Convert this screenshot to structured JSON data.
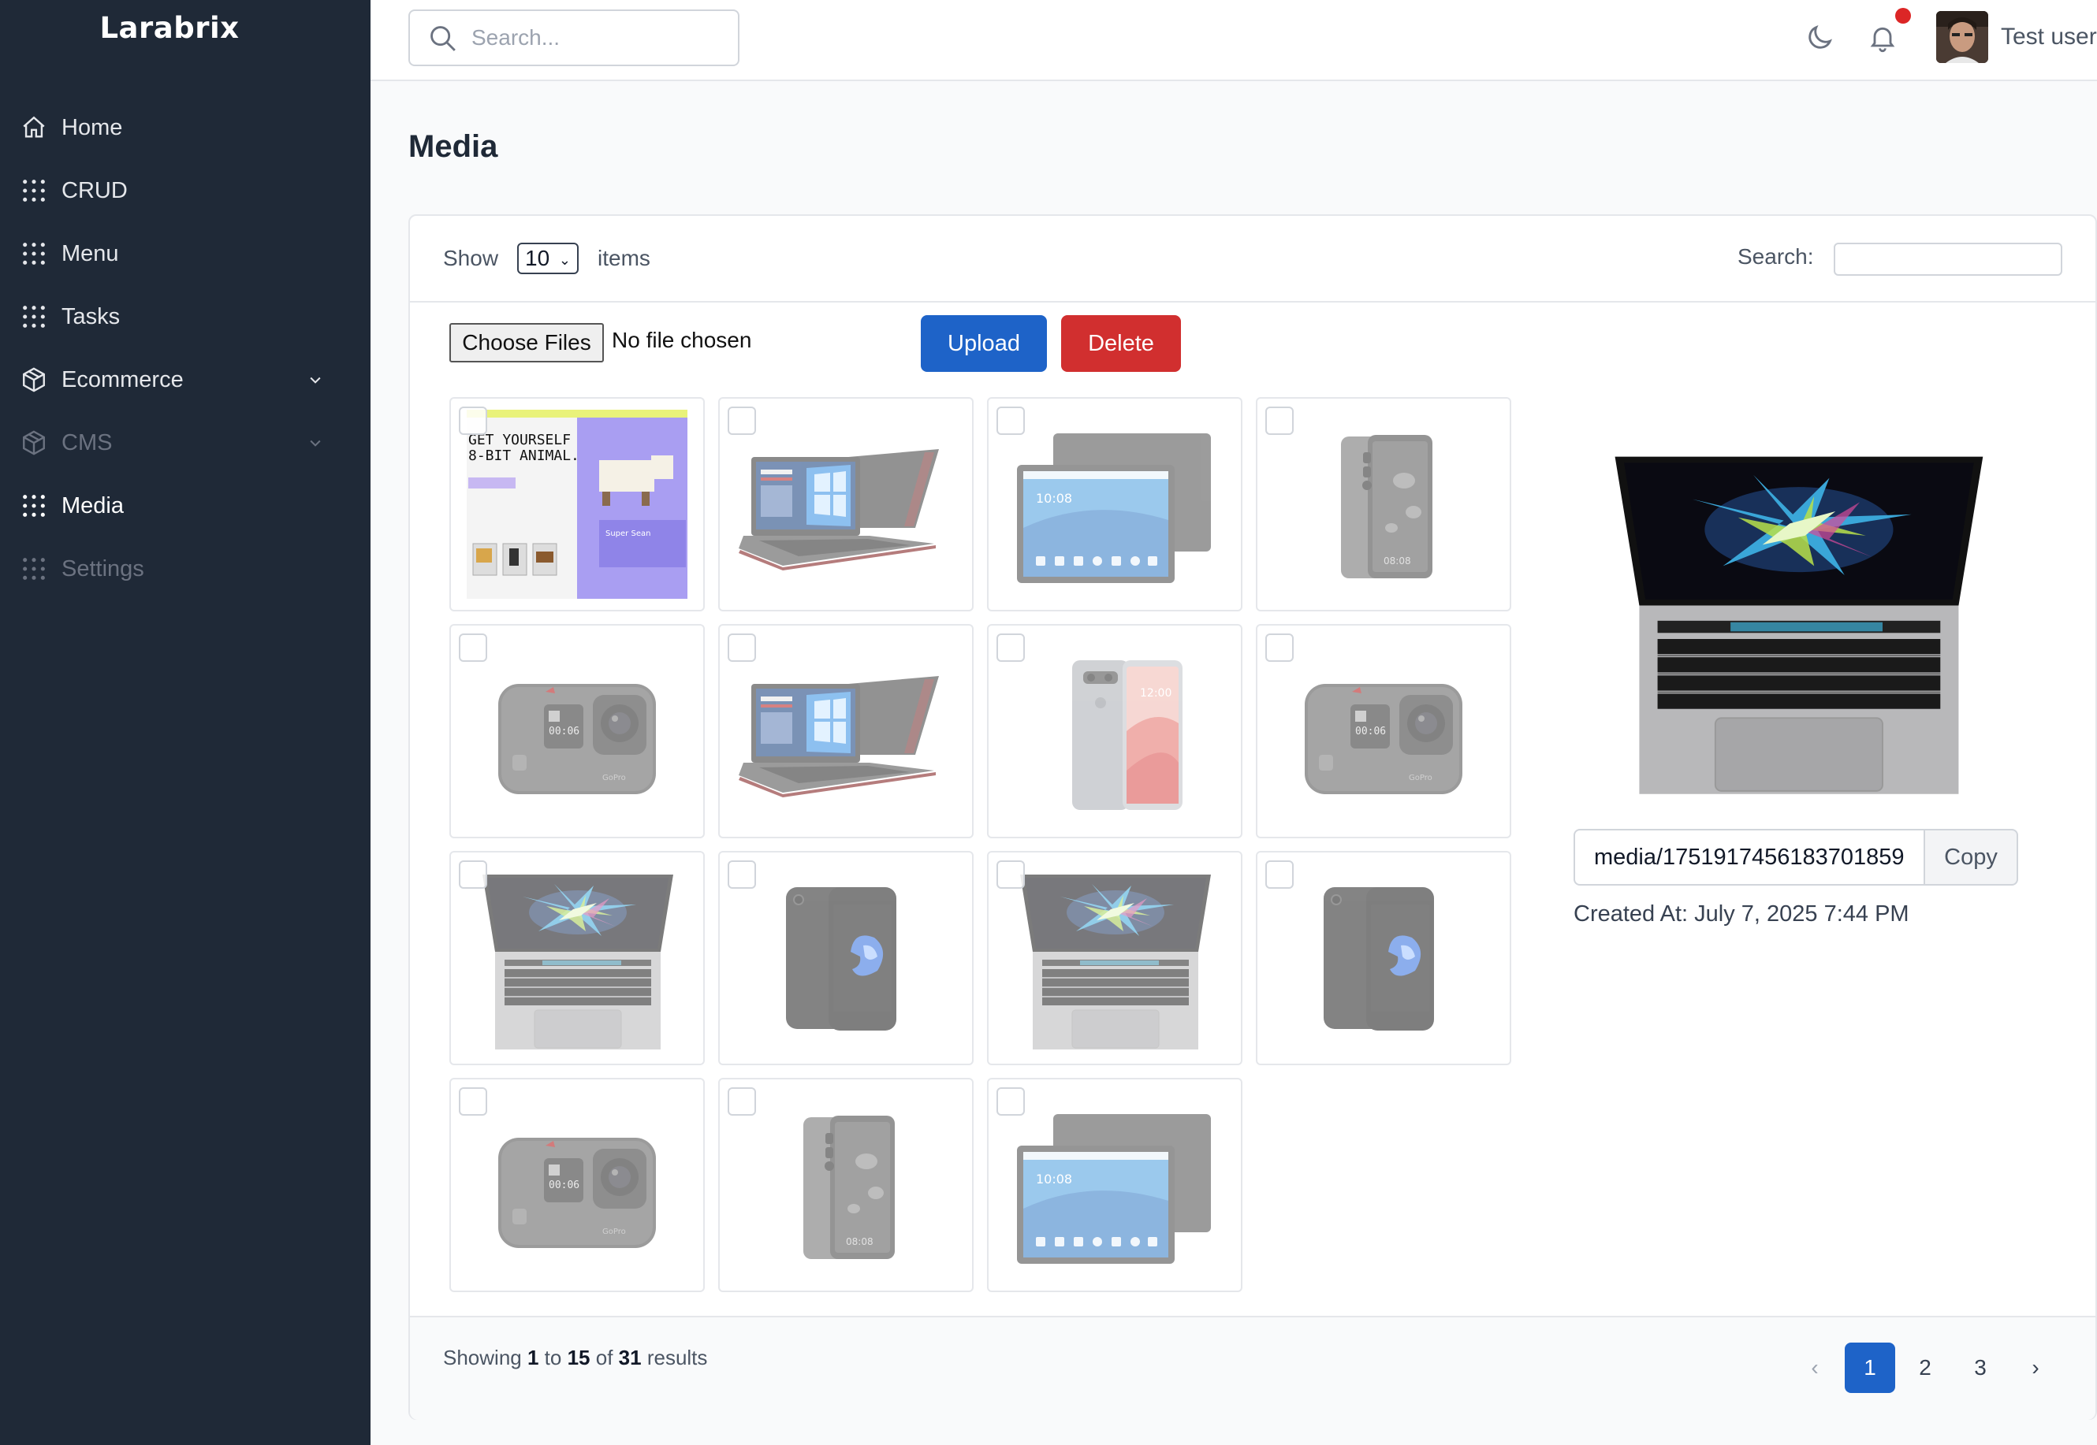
{
  "app": {
    "name": "Larabrix"
  },
  "sidebar": {
    "items": [
      {
        "label": "Home",
        "icon": "home-icon",
        "state": "normal"
      },
      {
        "label": "CRUD",
        "icon": "grid-dots-icon",
        "state": "normal"
      },
      {
        "label": "Menu",
        "icon": "grid-dots-icon",
        "state": "normal"
      },
      {
        "label": "Tasks",
        "icon": "grid-dots-icon",
        "state": "normal"
      },
      {
        "label": "Ecommerce",
        "icon": "cube-icon",
        "state": "normal",
        "expandable": true
      },
      {
        "label": "CMS",
        "icon": "cube-icon",
        "state": "dim",
        "expandable": true
      },
      {
        "label": "Media",
        "icon": "grid-dots-icon",
        "state": "active"
      },
      {
        "label": "Settings",
        "icon": "grid-dots-icon",
        "state": "dim"
      }
    ]
  },
  "header": {
    "search_placeholder": "Search...",
    "user_name": "Test user",
    "has_notification": true
  },
  "page": {
    "title": "Media"
  },
  "table_controls": {
    "show_label": "Show",
    "page_size": "10",
    "items_label": "items",
    "search_label": "Search:",
    "search_value": ""
  },
  "upload": {
    "choose_label": "Choose Files",
    "file_status": "No file chosen",
    "upload_label": "Upload",
    "delete_label": "Delete"
  },
  "media": [
    {
      "kind": "website"
    },
    {
      "kind": "laptop-msi"
    },
    {
      "kind": "tablet"
    },
    {
      "kind": "phone-mate"
    },
    {
      "kind": "camera"
    },
    {
      "kind": "laptop-msi"
    },
    {
      "kind": "phone-lg"
    },
    {
      "kind": "camera"
    },
    {
      "kind": "macbook"
    },
    {
      "kind": "iphone"
    },
    {
      "kind": "macbook"
    },
    {
      "kind": "iphone"
    },
    {
      "kind": "camera"
    },
    {
      "kind": "phone-mate"
    },
    {
      "kind": "tablet"
    }
  ],
  "detail": {
    "path": "media/1751917456183701859",
    "copy_label": "Copy",
    "created_at": "Created At: July 7, 2025 7:44 PM"
  },
  "pagination": {
    "showing_prefix": "Showing",
    "from": "1",
    "to_word": "to",
    "to": "15",
    "of_word": "of",
    "total": "31",
    "results_word": "results",
    "prev": "‹",
    "pages": [
      "1",
      "2",
      "3"
    ],
    "current": "1",
    "next": "›"
  },
  "colors": {
    "sidebar": "#1f2937",
    "primary": "#1e63c8",
    "danger": "#d12f2f",
    "notification": "#dc2626"
  }
}
